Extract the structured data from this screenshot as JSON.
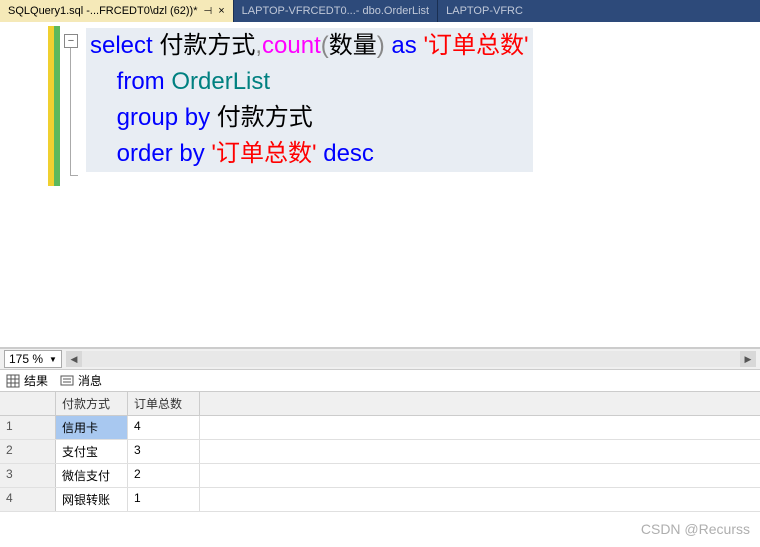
{
  "tabs": [
    {
      "label": "SQLQuery1.sql -...FRCEDT0\\dzl (62))*",
      "active": true
    },
    {
      "label": "LAPTOP-VFRCEDT0...- dbo.OrderList",
      "active": false
    },
    {
      "label": "LAPTOP-VFRC",
      "active": false
    }
  ],
  "pin_glyph": "⊣",
  "close_glyph": "×",
  "collapse_glyph": "−",
  "sql": {
    "line1": {
      "select": "select",
      "col1": " 付款方式",
      "comma": ",",
      "count": "count",
      "lp": "(",
      "arg": "数量",
      "rp": ")",
      "as": " as ",
      "alias": "'订单总数'"
    },
    "line2": {
      "from": "from ",
      "table": "OrderList"
    },
    "line3": {
      "groupby": "group by ",
      "col": "付款方式"
    },
    "line4": {
      "orderby": "order by ",
      "alias": "'订单总数'",
      "desc": " desc"
    }
  },
  "zoom": {
    "value": "175 %"
  },
  "results_tabs": {
    "results": "结果",
    "messages": "消息"
  },
  "grid": {
    "headers": [
      "",
      "付款方式",
      "订单总数"
    ],
    "rows": [
      {
        "n": "1",
        "a": "信用卡",
        "b": "4",
        "selected": true
      },
      {
        "n": "2",
        "a": "支付宝",
        "b": "3",
        "selected": false
      },
      {
        "n": "3",
        "a": "微信支付",
        "b": "2",
        "selected": false
      },
      {
        "n": "4",
        "a": "网银转账",
        "b": "1",
        "selected": false
      }
    ]
  },
  "watermark": "CSDN @Recurss"
}
